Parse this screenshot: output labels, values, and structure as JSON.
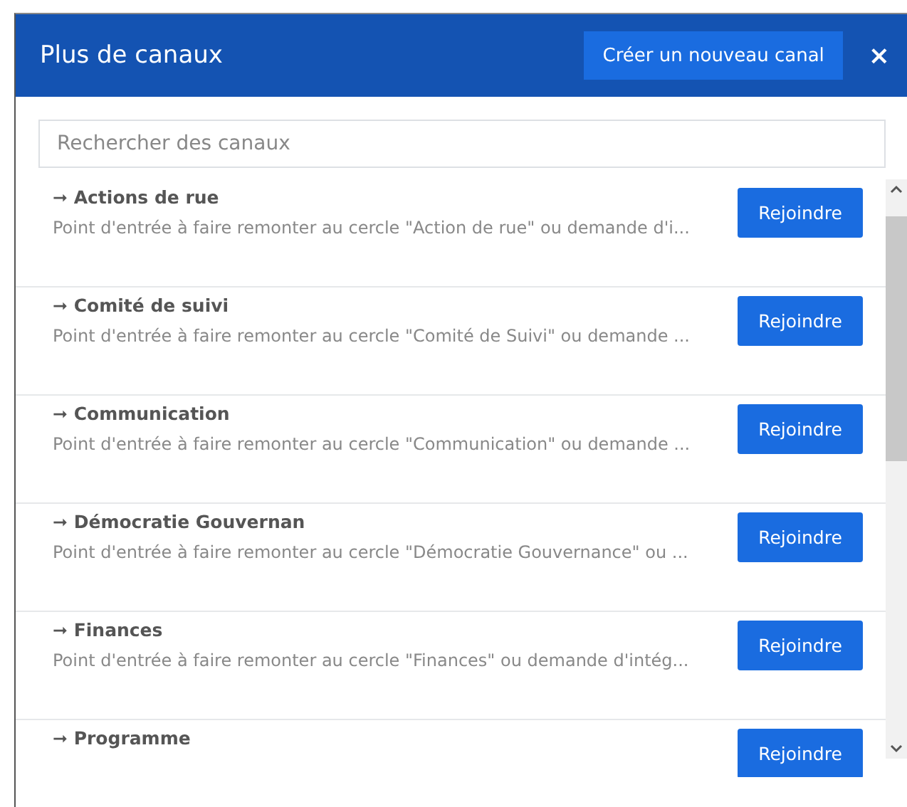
{
  "dialog": {
    "title": "Plus de canaux",
    "create_button": "Créer un nouveau canal",
    "close": "×"
  },
  "search": {
    "placeholder": "Rechercher des canaux"
  },
  "channels": [
    {
      "arrow": "➞",
      "name": "Actions de rue",
      "description": "Point d'entrée à faire remonter au cercle \"Action de rue\" ou demande d'i...",
      "button": "Rejoindre"
    },
    {
      "arrow": "➞",
      "name": "Comité de suivi",
      "description": "Point d'entrée à faire remonter au cercle \"Comité de Suivi\" ou demande ...",
      "button": "Rejoindre"
    },
    {
      "arrow": "➞",
      "name": "Communication",
      "description": "Point d'entrée à faire remonter au cercle \"Communication\" ou demande ...",
      "button": "Rejoindre"
    },
    {
      "arrow": "➞",
      "name": "Démocratie Gouvernan",
      "description": "Point d'entrée à faire remonter au cercle \"Démocratie Gouvernance\" ou ...",
      "button": "Rejoindre"
    },
    {
      "arrow": "➞",
      "name": "Finances",
      "description": "Point d'entrée à faire remonter au cercle \"Finances\" ou demande d'intég...",
      "button": "Rejoindre"
    },
    {
      "arrow": "➞",
      "name": "Programme",
      "button": "Rejoindre"
    }
  ]
}
